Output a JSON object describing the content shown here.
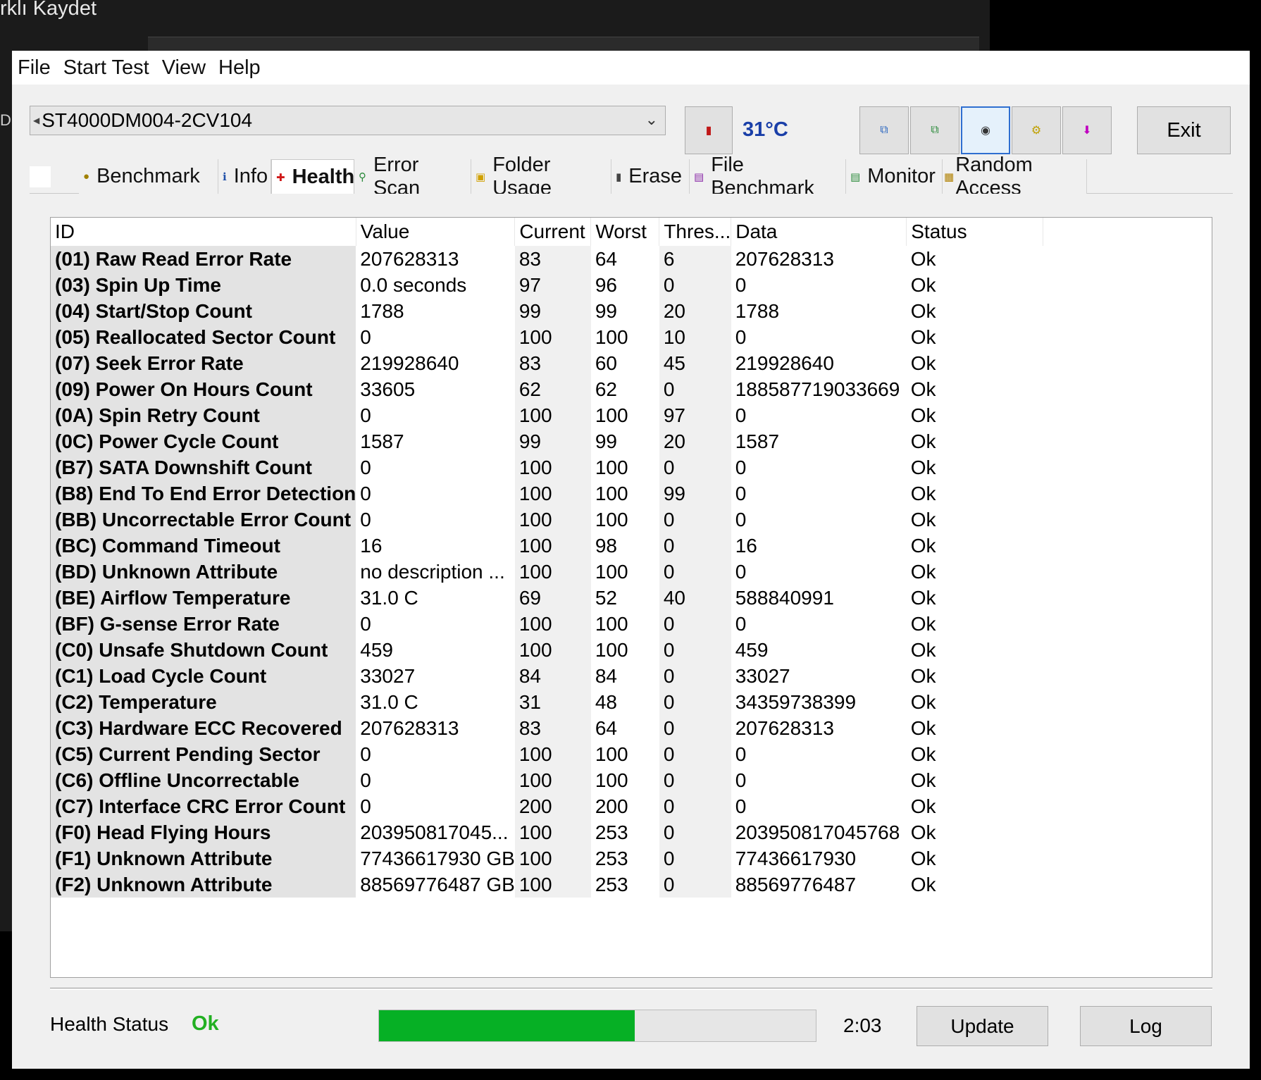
{
  "background": {
    "title": "rklı Kaydet"
  },
  "menu": [
    "File",
    "Start Test",
    "View",
    "Help"
  ],
  "toolbar": {
    "drive": "ST4000DM004-2CV104",
    "temperature": "31°C",
    "exit_label": "Exit"
  },
  "tabs": [
    {
      "label": "Benchmark",
      "icon": "benchmark-icon"
    },
    {
      "label": "Info",
      "icon": "info-icon"
    },
    {
      "label": "Health",
      "icon": "health-cross-icon"
    },
    {
      "label": "Error Scan",
      "icon": "magnifier-icon"
    },
    {
      "label": "Folder Usage",
      "icon": "folder-icon"
    },
    {
      "label": "Erase",
      "icon": "trash-icon"
    },
    {
      "label": "File Benchmark",
      "icon": "file-benchmark-icon"
    },
    {
      "label": "Monitor",
      "icon": "monitor-chart-icon"
    },
    {
      "label": "Random Access",
      "icon": "random-access-icon"
    }
  ],
  "active_tab": "Health",
  "table": {
    "headers": [
      "ID",
      "Value",
      "Current",
      "Worst",
      "Thres...",
      "Data",
      "Status"
    ],
    "rows": [
      [
        "(01) Raw Read Error Rate",
        "207628313",
        "83",
        "64",
        "6",
        "207628313",
        "Ok"
      ],
      [
        "(03) Spin Up Time",
        "0.0 seconds",
        "97",
        "96",
        "0",
        "0",
        "Ok"
      ],
      [
        "(04) Start/Stop Count",
        "1788",
        "99",
        "99",
        "20",
        "1788",
        "Ok"
      ],
      [
        "(05) Reallocated Sector Count",
        "0",
        "100",
        "100",
        "10",
        "0",
        "Ok"
      ],
      [
        "(07) Seek Error Rate",
        "219928640",
        "83",
        "60",
        "45",
        "219928640",
        "Ok"
      ],
      [
        "(09) Power On Hours Count",
        "33605",
        "62",
        "62",
        "0",
        "188587719033669",
        "Ok"
      ],
      [
        "(0A) Spin Retry Count",
        "0",
        "100",
        "100",
        "97",
        "0",
        "Ok"
      ],
      [
        "(0C) Power Cycle Count",
        "1587",
        "99",
        "99",
        "20",
        "1587",
        "Ok"
      ],
      [
        "(B7) SATA Downshift Count",
        "0",
        "100",
        "100",
        "0",
        "0",
        "Ok"
      ],
      [
        "(B8) End To End Error Detection",
        "0",
        "100",
        "100",
        "99",
        "0",
        "Ok"
      ],
      [
        "(BB) Uncorrectable Error Count",
        "0",
        "100",
        "100",
        "0",
        "0",
        "Ok"
      ],
      [
        "(BC) Command Timeout",
        "16",
        "100",
        "98",
        "0",
        "16",
        "Ok"
      ],
      [
        "(BD) Unknown Attribute",
        "no description ...",
        "100",
        "100",
        "0",
        "0",
        "Ok"
      ],
      [
        "(BE) Airflow Temperature",
        "31.0 C",
        "69",
        "52",
        "40",
        "588840991",
        "Ok"
      ],
      [
        "(BF) G-sense Error Rate",
        "0",
        "100",
        "100",
        "0",
        "0",
        "Ok"
      ],
      [
        "(C0) Unsafe Shutdown Count",
        "459",
        "100",
        "100",
        "0",
        "459",
        "Ok"
      ],
      [
        "(C1) Load Cycle Count",
        "33027",
        "84",
        "84",
        "0",
        "33027",
        "Ok"
      ],
      [
        "(C2) Temperature",
        "31.0 C",
        "31",
        "48",
        "0",
        "34359738399",
        "Ok"
      ],
      [
        "(C3) Hardware ECC Recovered",
        "207628313",
        "83",
        "64",
        "0",
        "207628313",
        "Ok"
      ],
      [
        "(C5) Current Pending Sector",
        "0",
        "100",
        "100",
        "0",
        "0",
        "Ok"
      ],
      [
        "(C6) Offline Uncorrectable",
        "0",
        "100",
        "100",
        "0",
        "0",
        "Ok"
      ],
      [
        "(C7) Interface CRC Error Count",
        "0",
        "200",
        "200",
        "0",
        "0",
        "Ok"
      ],
      [
        "(F0) Head Flying Hours",
        "203950817045...",
        "100",
        "253",
        "0",
        "203950817045768",
        "Ok"
      ],
      [
        "(F1) Unknown Attribute",
        "77436617930 GB",
        "100",
        "253",
        "0",
        "77436617930",
        "Ok"
      ],
      [
        "(F2) Unknown Attribute",
        "88569776487 GB",
        "100",
        "253",
        "0",
        "88569776487",
        "Ok"
      ]
    ]
  },
  "footer": {
    "health_label": "Health Status",
    "health_value": "Ok",
    "progress_fraction": 0.585,
    "time": "2:03",
    "update_label": "Update",
    "log_label": "Log"
  },
  "colors": {
    "health_ok": "#22b022",
    "progress_fill": "#06b025",
    "temperature_text": "#1a3fa8"
  }
}
